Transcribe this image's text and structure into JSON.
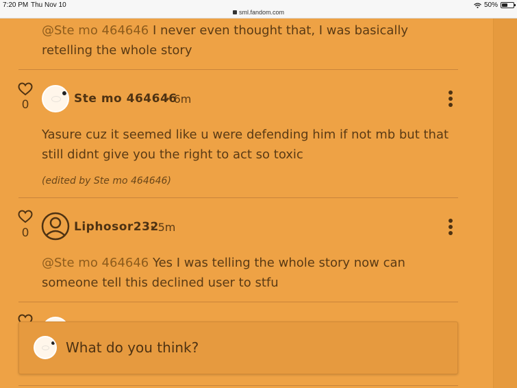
{
  "status_bar": {
    "time": "7:20 PM",
    "date": "Thu Nov 10",
    "url": "sml.fandom.com",
    "battery": "50%",
    "battery_level": 0.5
  },
  "comments": [
    {
      "mention": "@Ste mo 464646",
      "body": " I never even thought that, I was basically retelling the whole story"
    },
    {
      "likes": "0",
      "author": "Ste mo 464646",
      "time": "6m",
      "body": "Yasure cuz it seemed like u were defending him if not mb but that still didnt give you the right to act so toxic",
      "edited_note": "(edited by Ste mo 464646)"
    },
    {
      "likes": "0",
      "author": "Liphosor232",
      "time": "5m",
      "mention": "@Ste mo 464646",
      "body": " Yes I was telling the whole story now can someone tell this declined user to stfu"
    }
  ],
  "separator": "•",
  "composer": {
    "placeholder": "What do you think?"
  },
  "colors": {
    "background": "#eea245",
    "text": "#5a3a14",
    "mention": "#8e5c1c"
  }
}
